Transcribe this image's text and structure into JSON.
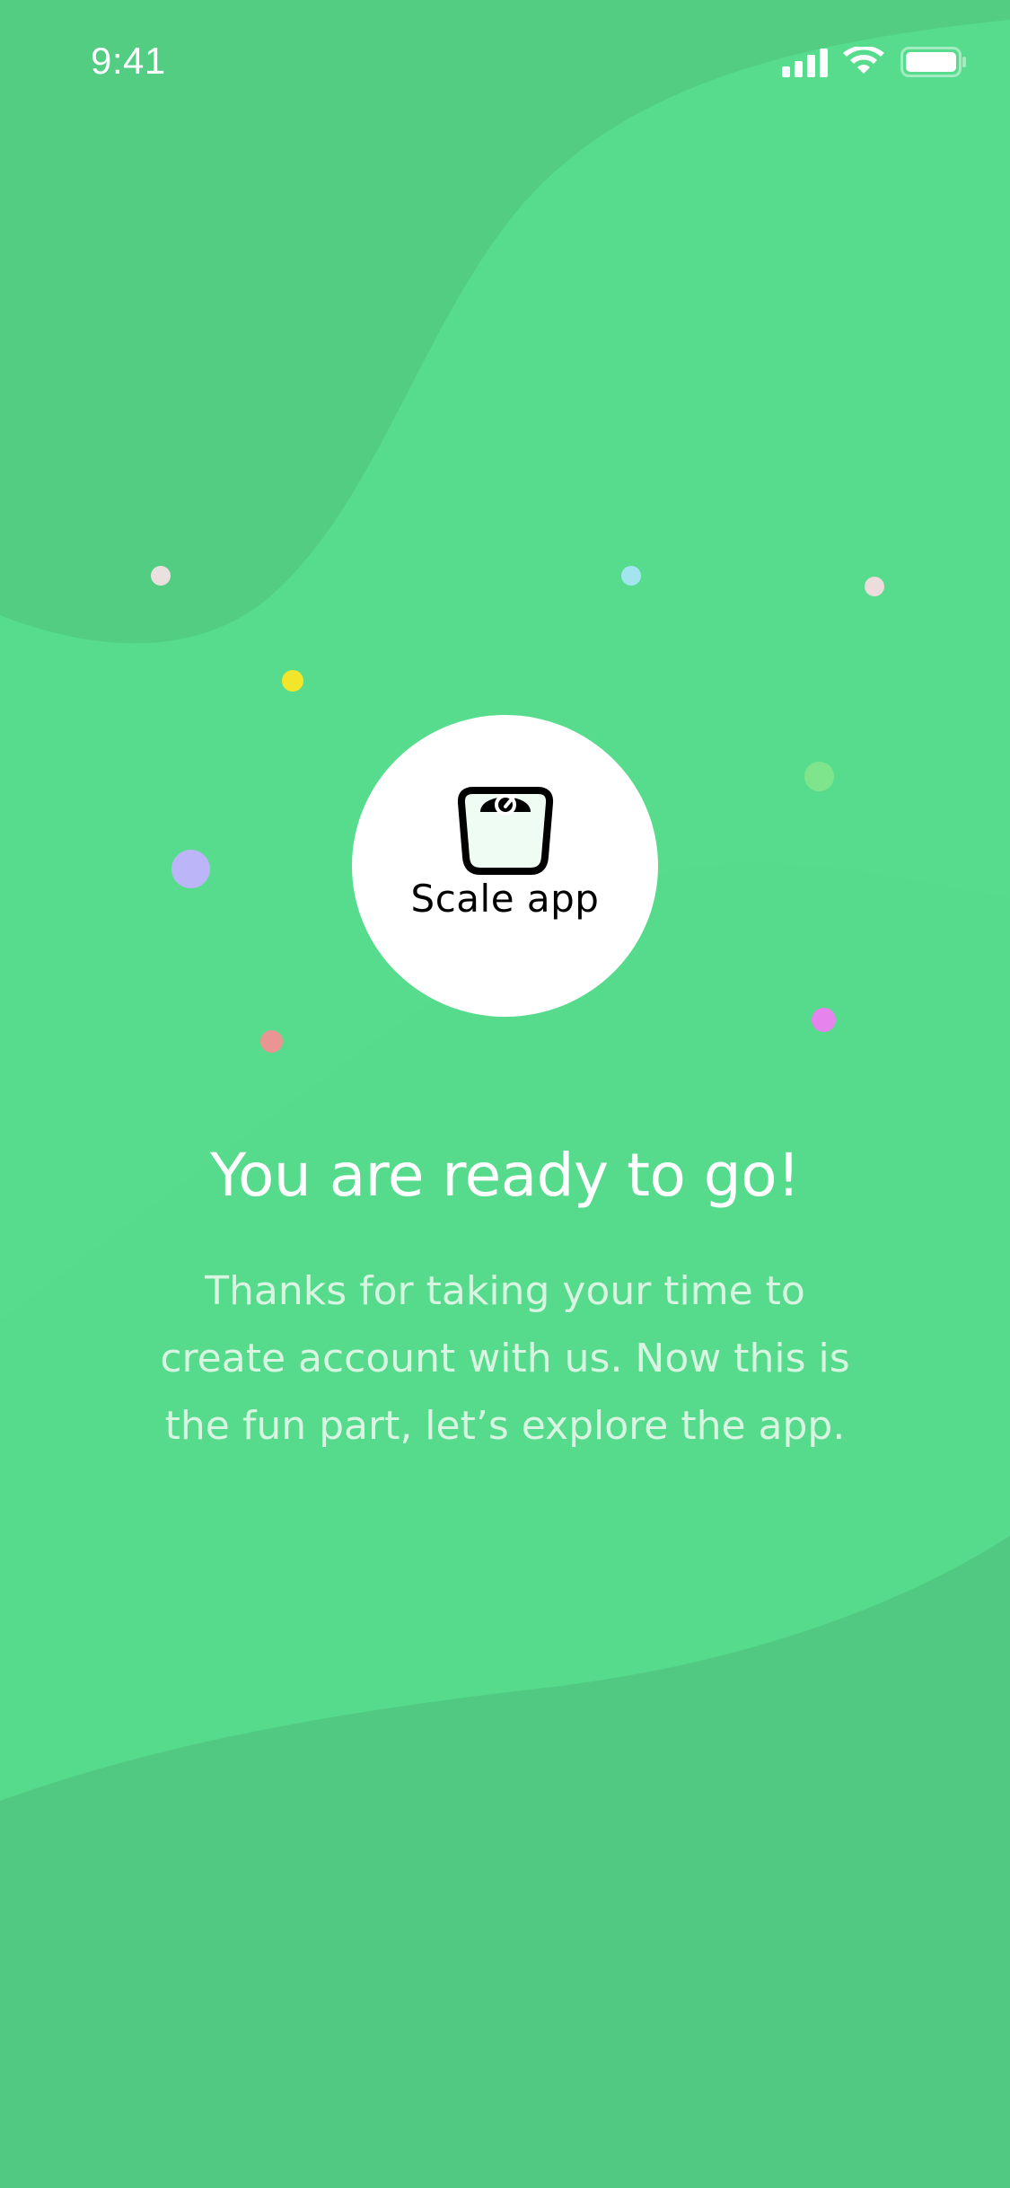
{
  "status_bar": {
    "time": "9:41",
    "icons": [
      "signal-icon",
      "wifi-icon",
      "battery-icon"
    ]
  },
  "logo": {
    "icon": "scale-icon",
    "wordmark": "Scale app"
  },
  "content": {
    "title": "You are ready to go!",
    "subtitle_lines": [
      "Thanks for taking your time to",
      "create account with us. Now this is",
      "the fun part, let’s explore the app."
    ]
  },
  "colors": {
    "background": "#57dc8d",
    "wave_top": "#52cd82",
    "wave_mid": "#55d98a",
    "wave_bottom": "#51c982",
    "text_primary": "#ffffff",
    "text_secondary": "#d8f5e1",
    "logo_circle": "#ffffff",
    "logo_fill": "#eefcf3"
  },
  "confetti_colors": [
    "#e9e0df",
    "#a3e5ee",
    "#ecdcdb",
    "#f2e52a",
    "#7ee58d",
    "#bcb5f8",
    "#f0c326",
    "#ea9493",
    "#e783ec"
  ]
}
